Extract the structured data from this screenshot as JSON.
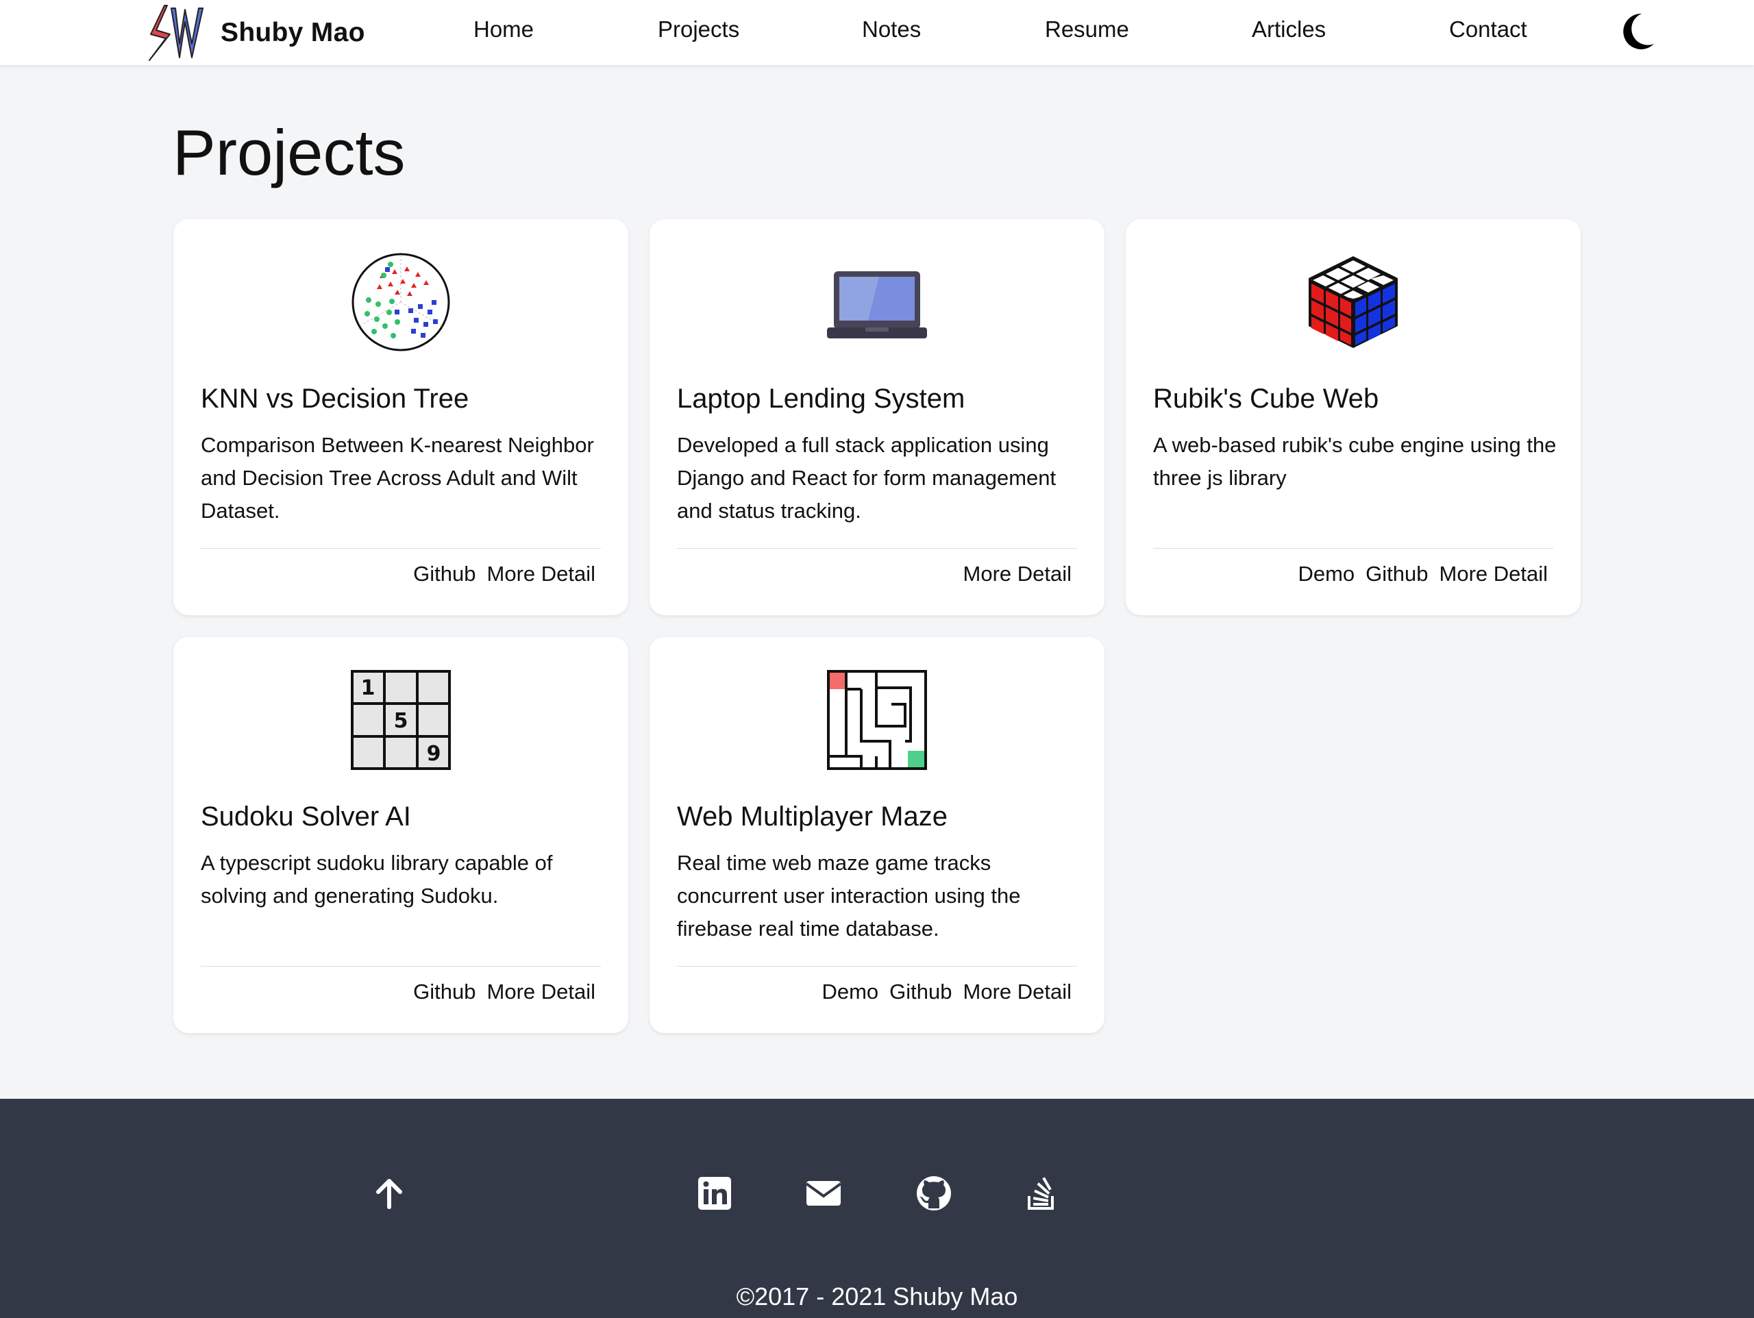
{
  "brand": {
    "name": "Shuby Mao"
  },
  "nav": {
    "items": [
      {
        "label": "Home"
      },
      {
        "label": "Projects"
      },
      {
        "label": "Notes"
      },
      {
        "label": "Resume"
      },
      {
        "label": "Articles"
      },
      {
        "label": "Contact"
      }
    ],
    "theme_toggle_icon": "moon-icon"
  },
  "page": {
    "title": "Projects"
  },
  "projects": [
    {
      "title": "KNN vs Decision Tree",
      "description": "Comparison Between K-nearest Neighbor and Decision Tree Across Adult and Wilt Dataset.",
      "icon": "scatter-classification-icon",
      "links": [
        "Github",
        "More Detail"
      ]
    },
    {
      "title": "Laptop Lending System",
      "description": "Developed a full stack application using Django and React for form management and status tracking.",
      "icon": "laptop-icon",
      "links": [
        "More Detail"
      ]
    },
    {
      "title": "Rubik's Cube Web",
      "description": "A web-based rubik's cube engine using the three js library",
      "icon": "rubiks-cube-icon",
      "links": [
        "Demo",
        "Github",
        "More Detail"
      ]
    },
    {
      "title": "Sudoku Solver AI",
      "description": "A typescript sudoku library capable of solving and generating Sudoku.",
      "icon": "sudoku-grid-icon",
      "sudoku_digits": [
        "1",
        "5",
        "9"
      ],
      "links": [
        "Github",
        "More Detail"
      ]
    },
    {
      "title": "Web Multiplayer Maze",
      "description": "Real time web maze game tracks concurrent user interaction using the firebase real time database.",
      "icon": "maze-icon",
      "links": [
        "Demo",
        "Github",
        "More Detail"
      ]
    }
  ],
  "footer": {
    "icons": [
      "arrow-up-icon",
      "linkedin-icon",
      "email-icon",
      "github-icon",
      "stackoverflow-icon"
    ],
    "copyright": "©2017 - 2021 Shuby Mao"
  },
  "colors": {
    "page_bg": "#f4f5f7",
    "footer_bg": "#323846",
    "logo_red": "#e0454f",
    "logo_blue": "#5b6fd6"
  }
}
